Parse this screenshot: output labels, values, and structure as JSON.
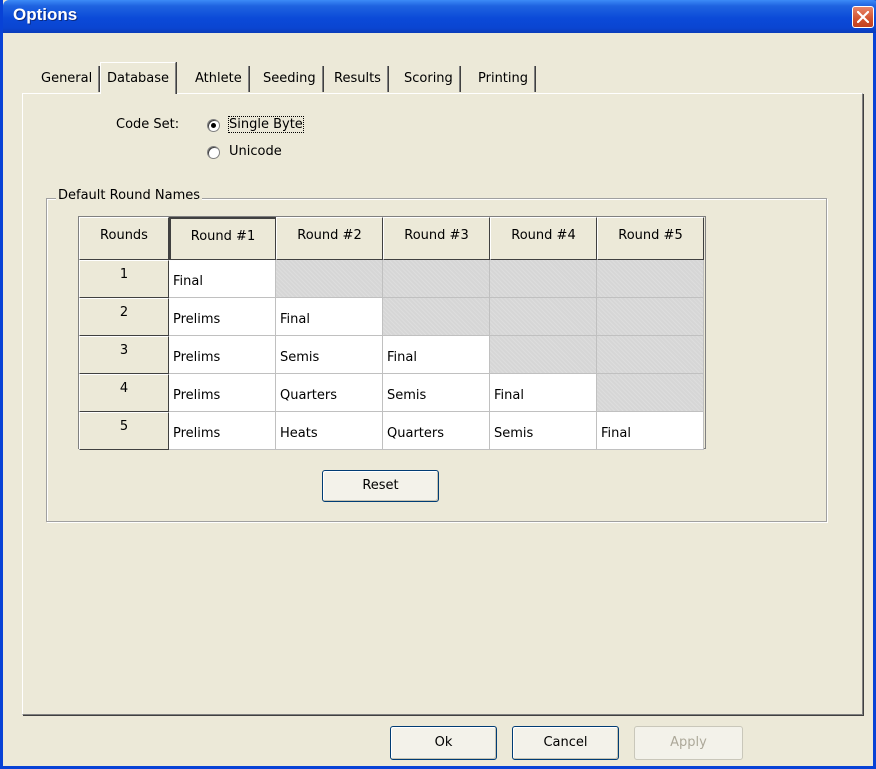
{
  "window": {
    "title": "Options"
  },
  "tabs": [
    {
      "label": "General",
      "active": false
    },
    {
      "label": "Database",
      "active": true
    },
    {
      "label": "Athlete",
      "active": false
    },
    {
      "label": "Seeding",
      "active": false
    },
    {
      "label": "Results",
      "active": false
    },
    {
      "label": "Scoring",
      "active": false
    },
    {
      "label": "Printing",
      "active": false
    }
  ],
  "code_set": {
    "label": "Code Set:",
    "options": [
      {
        "label": "Single Byte",
        "selected": true
      },
      {
        "label": "Unicode",
        "selected": false
      }
    ]
  },
  "round_names": {
    "group_label": "Default Round Names",
    "headers": [
      "Rounds",
      "Round #1",
      "Round #2",
      "Round #3",
      "Round #4",
      "Round #5"
    ],
    "rows": [
      {
        "rounds": "1",
        "names": [
          "Final"
        ]
      },
      {
        "rounds": "2",
        "names": [
          "Prelims",
          "Final"
        ]
      },
      {
        "rounds": "3",
        "names": [
          "Prelims",
          "Semis",
          "Final"
        ]
      },
      {
        "rounds": "4",
        "names": [
          "Prelims",
          "Quarters",
          "Semis",
          "Final"
        ]
      },
      {
        "rounds": "5",
        "names": [
          "Prelims",
          "Heats",
          "Quarters",
          "Semis",
          "Final"
        ]
      }
    ],
    "reset_label": "Reset"
  },
  "buttons": {
    "ok": "Ok",
    "cancel": "Cancel",
    "apply": "Apply"
  }
}
